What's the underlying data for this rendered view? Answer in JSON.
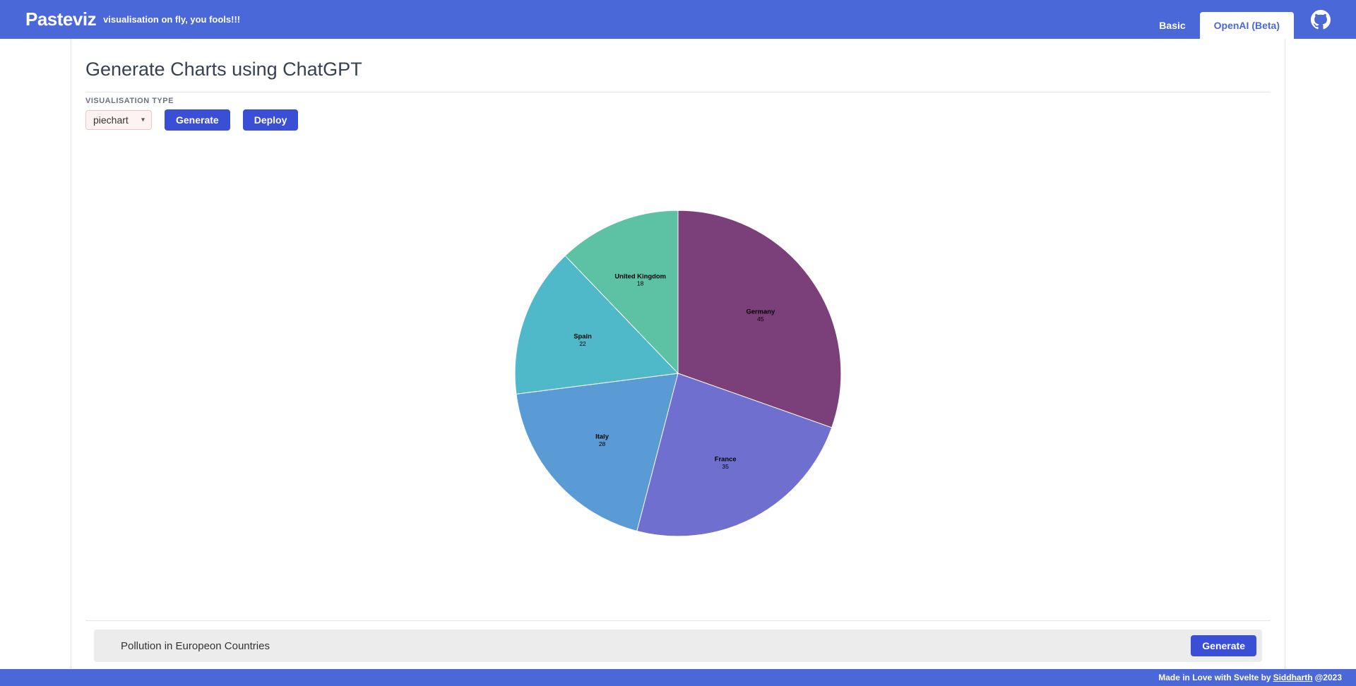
{
  "nav": {
    "brand": "Pasteviz",
    "tagline": "visualisation on fly, you fools!!!",
    "tabs": [
      {
        "label": "Basic",
        "active": false
      },
      {
        "label": "OpenAI (Beta)",
        "active": true
      }
    ]
  },
  "page": {
    "title": "Generate Charts using ChatGPT",
    "vis_type_label": "VISUALISATION TYPE",
    "vis_type_value": "piechart",
    "generate_label": "Generate",
    "deploy_label": "Deploy",
    "prompt_value": "Pollution in Europeon Countries",
    "prompt_generate_label": "Generate"
  },
  "footer": {
    "prefix": "Made in Love with Svelte by ",
    "author": "Siddharth",
    "suffix": " @2023"
  },
  "chart_data": {
    "type": "pie",
    "title": "",
    "series": [
      {
        "name": "Germany",
        "value": 45,
        "color": "#7b3f7a"
      },
      {
        "name": "France",
        "value": 35,
        "color": "#6f6fcf"
      },
      {
        "name": "Italy",
        "value": 28,
        "color": "#5b9bd5"
      },
      {
        "name": "Spain",
        "value": 22,
        "color": "#4fb8c9"
      },
      {
        "name": "United Kingdom",
        "value": 18,
        "color": "#5dc2a3"
      }
    ]
  }
}
